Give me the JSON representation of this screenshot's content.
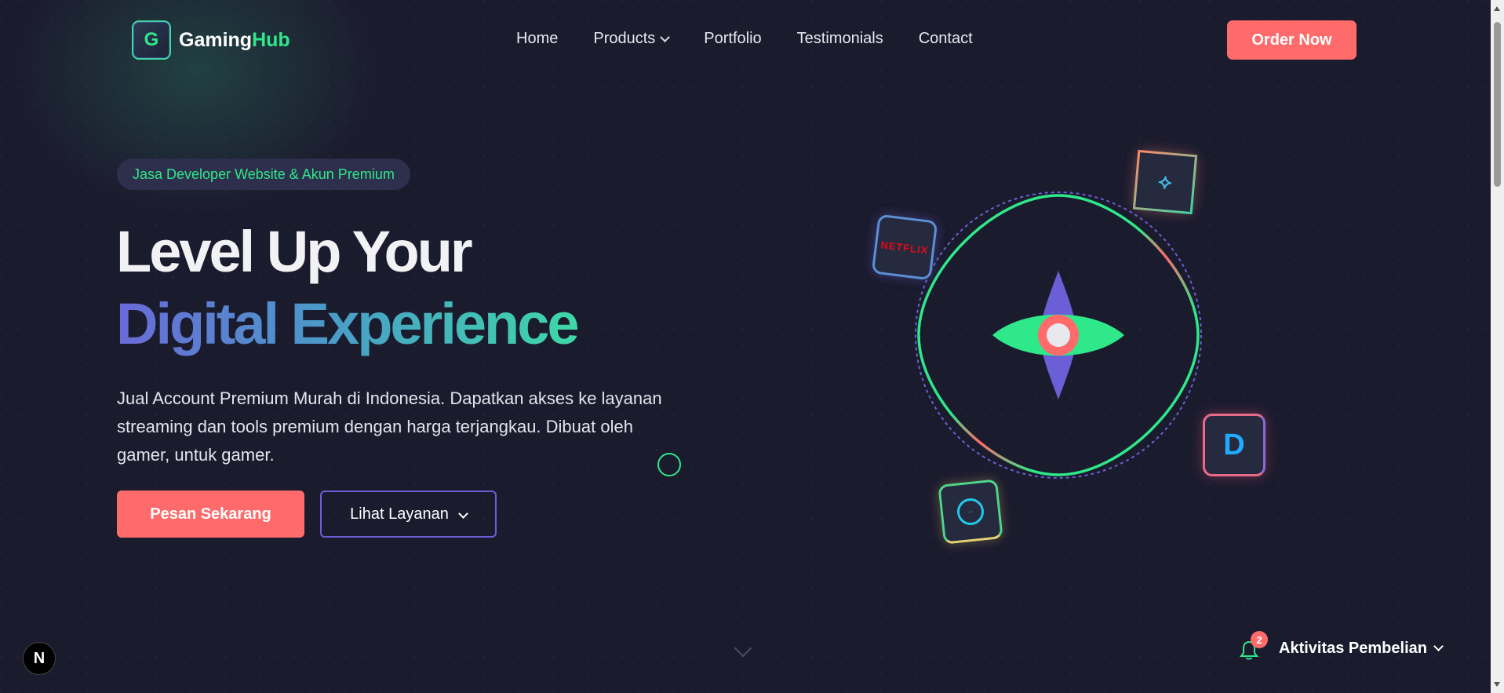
{
  "brand": {
    "initial": "G",
    "name_part1": "Gaming",
    "name_part2": "Hub"
  },
  "nav": {
    "home": "Home",
    "products": "Products",
    "portfolio": "Portfolio",
    "testimonials": "Testimonials",
    "contact": "Contact"
  },
  "header": {
    "order_button": "Order Now"
  },
  "hero": {
    "badge": "Jasa Developer Website & Akun Premium",
    "headline_line1": "Level Up Your",
    "headline_line2": "Digital Experience",
    "description": "Jual Account Premium Murah di Indonesia. Dapatkan akses ke layanan streaming dan tools premium dengan harga terjangkau. Dibuat oleh gamer, untuk gamer.",
    "primary_button": "Pesan Sekarang",
    "secondary_button": "Lihat Layanan"
  },
  "graphic": {
    "tiles": {
      "netflix": "NETFLIX",
      "openai": "⟡",
      "d_app": "D",
      "circle_app": "··"
    }
  },
  "framework_badge": "N",
  "activity": {
    "count": "2",
    "label": "Aktivitas Pembelian"
  },
  "colors": {
    "accent": "#ff6b6b",
    "brand_green": "#2ee88a",
    "background": "#1b1b2e",
    "outline_purple": "#6a5fd6"
  }
}
